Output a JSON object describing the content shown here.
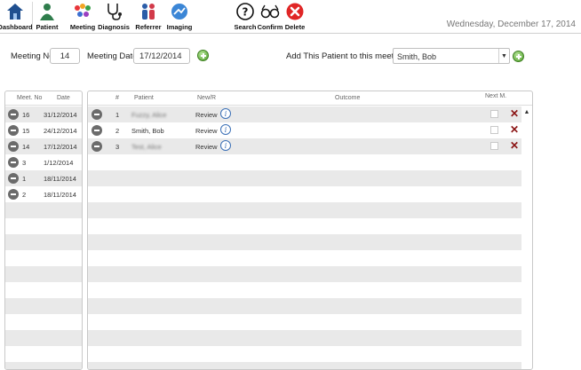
{
  "toolbar": {
    "dashboard": "Dashboard",
    "patient": "Patient",
    "meeting": "Meeting",
    "diagnosis": "Diagnosis",
    "referrer": "Referrer",
    "imaging": "Imaging",
    "search": "Search",
    "confirm": "Confirm",
    "delete": "Delete",
    "current_date": "Wednesday, December 17, 2014"
  },
  "meeting": {
    "no_label": "Meeting No:",
    "no_value": "14",
    "date_label": "Meeting Date:",
    "date_value": "17/12/2014",
    "add_patient_label": "Add This Patient to this meeting:",
    "selected_patient": "Smith, Bob"
  },
  "meetings_list": {
    "headers": {
      "no": "Meet. No",
      "date": "Date"
    },
    "rows": [
      {
        "no": "16",
        "date": "31/12/2014"
      },
      {
        "no": "15",
        "date": "24/12/2014"
      },
      {
        "no": "14",
        "date": "17/12/2014"
      },
      {
        "no": "3",
        "date": "1/12/2014"
      },
      {
        "no": "1",
        "date": "18/11/2014"
      },
      {
        "no": "2",
        "date": "18/11/2014"
      }
    ]
  },
  "patients_list": {
    "headers": {
      "num": "#",
      "patient": "Patient",
      "newr": "New/R",
      "outcome": "Outcome",
      "next": "Next M."
    },
    "rows": [
      {
        "num": "1",
        "patient": "Fuzzy, Alice",
        "newr": "Review"
      },
      {
        "num": "2",
        "patient": "Smith, Bob",
        "newr": "Review"
      },
      {
        "num": "3",
        "patient": "Test, Alice",
        "newr": "Review"
      }
    ]
  }
}
